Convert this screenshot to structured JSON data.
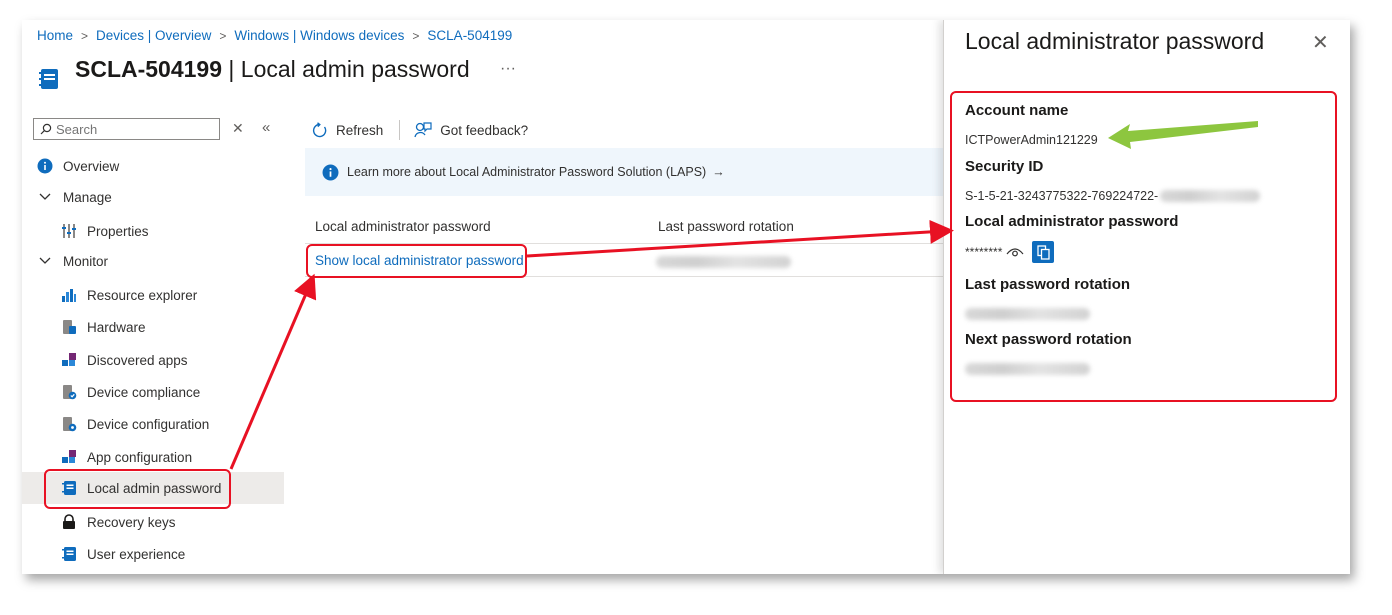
{
  "breadcrumb": [
    "Home",
    "Devices | Overview",
    "Windows | Windows devices",
    "SCLA-504199"
  ],
  "page": {
    "title_main": "SCLA-504199",
    "title_rest": " | Local admin password",
    "more": "···"
  },
  "sidebar": {
    "search_placeholder": "Search",
    "clear": "✕",
    "collapse": "«",
    "items": [
      {
        "label": "Overview",
        "icon": "info-icon"
      },
      {
        "label": "Manage",
        "icon": "chevron-down-icon"
      },
      {
        "label": "Properties",
        "icon": "properties-icon"
      },
      {
        "label": "Monitor",
        "icon": "chevron-down-icon"
      },
      {
        "label": "Resource explorer",
        "icon": "resource-explorer-icon"
      },
      {
        "label": "Hardware",
        "icon": "hardware-icon"
      },
      {
        "label": "Discovered apps",
        "icon": "apps-icon"
      },
      {
        "label": "Device compliance",
        "icon": "compliance-icon"
      },
      {
        "label": "Device configuration",
        "icon": "configuration-icon"
      },
      {
        "label": "App configuration",
        "icon": "apps-icon"
      },
      {
        "label": "Local admin password",
        "icon": "notebook-icon"
      },
      {
        "label": "Recovery keys",
        "icon": "lock-icon"
      },
      {
        "label": "User experience",
        "icon": "notebook-icon"
      }
    ]
  },
  "toolbar": {
    "refresh": "Refresh",
    "feedback": "Got feedback?"
  },
  "info": {
    "text": "Learn more about Local Administrator Password Solution (LAPS)",
    "arrow": "→"
  },
  "table": {
    "col1": "Local administrator password",
    "col2": "Last password rotation",
    "show_link": "Show local administrator password"
  },
  "panel": {
    "title": "Local administrator password",
    "close": "✕",
    "account_label": "Account name",
    "account_value": "ICTPowerAdmin121229",
    "sid_label": "Security ID",
    "sid_value": "S-1-5-21-3243775322-769224722-",
    "pw_label": "Local administrator password",
    "pw_masked": "********",
    "last_label": "Last password rotation",
    "next_label": "Next password rotation"
  },
  "colors": {
    "accent": "#0f6cbd",
    "highlight": "#e81123",
    "pointer_arrow": "#8dc63f"
  }
}
